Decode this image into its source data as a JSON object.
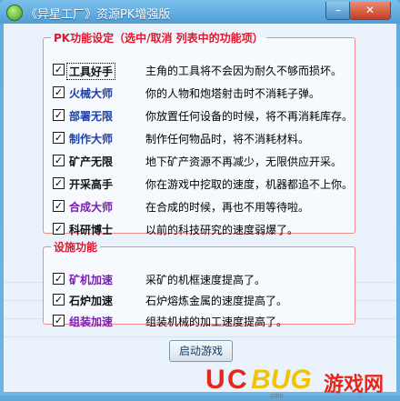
{
  "window": {
    "title": "《异星工厂》资源PK增强版",
    "min_label": "–",
    "close_label": "✕"
  },
  "pk_group": {
    "legend": "PK功能设定（选中/取消 列表中的功能项）",
    "items": [
      {
        "name": "工具好手",
        "desc": "主角的工具将不会因为耐久不够而损坏。",
        "checked": true,
        "color": "#111111"
      },
      {
        "name": "火械大师",
        "desc": "你的人物和炮塔射击时不消耗子弹。",
        "checked": true,
        "color": "#1a3fa6"
      },
      {
        "name": "部署无限",
        "desc": "你放置任何设备的时候，将不再消耗库存。",
        "checked": true,
        "color": "#1a3fa6"
      },
      {
        "name": "制作大师",
        "desc": "制作任何物品时，将不消耗材料。",
        "checked": true,
        "color": "#1a3fa6"
      },
      {
        "name": "矿产无限",
        "desc": "地下矿产资源不再减少，无限供应开采。",
        "checked": true,
        "color": "#111111"
      },
      {
        "name": "开采高手",
        "desc": "你在游戏中挖取的速度，机器都追不上你。",
        "checked": true,
        "color": "#111111"
      },
      {
        "name": "合成大师",
        "desc": "在合成的时候，再也不用等待啦。",
        "checked": true,
        "color": "#7a1fb0"
      },
      {
        "name": "科研博士",
        "desc": "以前的科技研究的速度弱爆了。",
        "checked": true,
        "color": "#111111"
      }
    ]
  },
  "facility_group": {
    "legend": "设施功能",
    "items": [
      {
        "name": "矿机加速",
        "desc": "采矿的机框速度提高了。",
        "checked": true,
        "color": "#7a1fb0"
      },
      {
        "name": "石炉加速",
        "desc": "石炉熔炼金属的速度提高了。",
        "checked": true,
        "color": "#111111"
      },
      {
        "name": "组装加速",
        "desc": "组装机械的加工速度提高了。",
        "checked": true,
        "color": "#7a1fb0"
      }
    ]
  },
  "start_button": {
    "label": "启动游戏"
  },
  "watermark": {
    "u": "U",
    "c": "C",
    "bug": "BUG",
    "cn": "游戏网",
    "url": ".com"
  }
}
